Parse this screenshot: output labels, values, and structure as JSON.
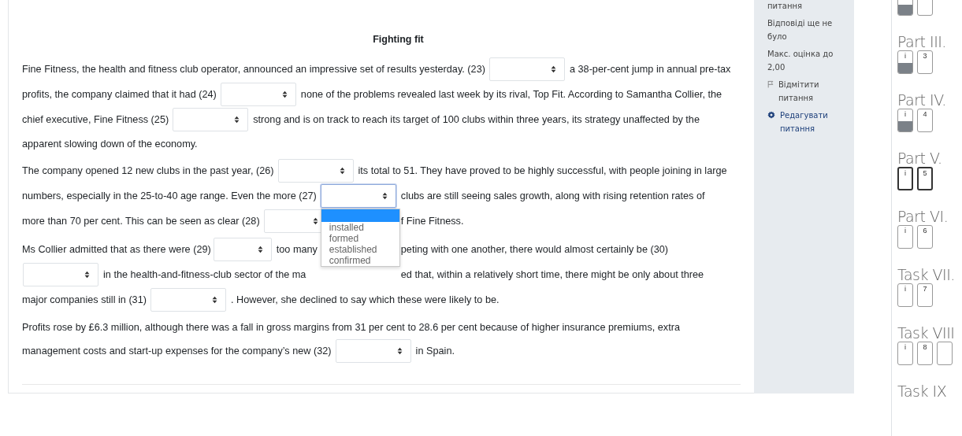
{
  "passage": {
    "title": "Fighting fit",
    "paragraphs": [
      {
        "lines": [
          [
            {
              "kind": "text",
              "text": "Fine Fitness, the health and fitness club operator, announced an impressive set of results yesterday. (23)"
            },
            {
              "kind": "select",
              "open": false
            },
            {
              "kind": "text",
              "text": "a 38-per-cent jump in annual pre-tax"
            }
          ],
          [
            {
              "kind": "text",
              "text": "profits, the company claimed that it had (24)"
            },
            {
              "kind": "select",
              "open": false
            },
            {
              "kind": "text",
              "text": "none of the problems revealed last week by its rival, Top Fit. According to Samantha Collier, the"
            }
          ],
          [
            {
              "kind": "text",
              "text": "chief executive, Fine Fitness (25)"
            },
            {
              "kind": "select",
              "open": false
            },
            {
              "kind": "text",
              "text": "strong and is on track to reach its target of 100 clubs within three years, its strategy unaffected by the"
            }
          ],
          [
            {
              "kind": "text",
              "text": "apparent slowing down of the economy."
            }
          ]
        ]
      },
      {
        "lines": [
          [
            {
              "kind": "text",
              "text": "The company opened 12 new clubs in the past year, (26)"
            },
            {
              "kind": "select",
              "open": false
            },
            {
              "kind": "text",
              "text": "its total to 51. They have proved to be highly successful, with people joining in large"
            }
          ],
          [
            {
              "kind": "text",
              "text": "numbers, especially in the 25-to-40 age range. Even the more (27)"
            },
            {
              "kind": "select",
              "open": true,
              "options": [
                {
                  "selected": true
                },
                {
                  "label": "installed",
                  "selected": false
                },
                {
                  "label": "formed",
                  "selected": false
                },
                {
                  "label": "established",
                  "selected": false
                },
                {
                  "label": "confirmed",
                  "selected": false
                }
              ]
            },
            {
              "kind": "text",
              "text": "clubs are still seeing sales growth, along with rising retention rates of"
            }
          ],
          [
            {
              "kind": "text",
              "text": "more than 70 per cent. This can be seen as clear (28)"
            },
            {
              "kind": "select",
              "open": false
            },
            {
              "kind": "covered"
            },
            {
              "kind": "text",
              "text": "f Fine Fitness."
            }
          ]
        ]
      },
      {
        "lines": [
          [
            {
              "kind": "text",
              "text": "Ms Collier admitted that as there were (29)"
            },
            {
              "kind": "select",
              "open": false
            },
            {
              "kind": "text",
              "text": "too many"
            },
            {
              "kind": "covered"
            },
            {
              "kind": "text",
              "text": "peting with one another, there would almost certainly be (30)"
            }
          ],
          [
            {
              "kind": "select",
              "open": false
            },
            {
              "kind": "text",
              "text": "in the health-and-fitness-club sector of the ma"
            },
            {
              "kind": "covered"
            },
            {
              "kind": "text",
              "text": "ed that, within a relatively short time, there might be only about three"
            }
          ],
          [
            {
              "kind": "text",
              "text": "major companies still in (31)"
            },
            {
              "kind": "select",
              "open": false
            },
            {
              "kind": "text",
              "text": ". However, she declined to say which these were likely to be."
            }
          ]
        ]
      },
      {
        "lines": [
          [
            {
              "kind": "text",
              "text": "Profits rose by £6.3 million, although there was a fall in gross margins from 31 per cent to 28.6 per cent because of higher insurance premiums, extra"
            }
          ],
          [
            {
              "kind": "text",
              "text": "management costs and start-up expenses for the company’s new (32)"
            },
            {
              "kind": "select",
              "open": false
            },
            {
              "kind": "text",
              "text": "in Spain."
            }
          ]
        ]
      }
    ]
  },
  "question_info": {
    "label": "питання",
    "status": "Відповіді ще не було",
    "max_grade": "Макс. оцінка до 2,00",
    "flag_link": "Відмітити питання",
    "edit_link": "Редагувати питання"
  },
  "quiz_navigation": {
    "sections": [
      {
        "buttons": [
          {
            "answered": true,
            "current": false
          },
          {
            "answered": false,
            "current": false
          }
        ]
      },
      {
        "title": "Part III.",
        "buttons": [
          {
            "label": "i",
            "answered": true,
            "current": false
          },
          {
            "label": "3",
            "answered": false,
            "current": false
          }
        ]
      },
      {
        "title": "Part IV.",
        "buttons": [
          {
            "label": "i",
            "answered": true,
            "current": false
          },
          {
            "label": "4",
            "answered": false,
            "current": false
          }
        ]
      },
      {
        "title": "Part V.",
        "buttons": [
          {
            "label": "i",
            "answered": false,
            "current": true
          },
          {
            "label": "5",
            "answered": false,
            "current": true
          }
        ]
      },
      {
        "title": "Part VI.",
        "buttons": [
          {
            "label": "i",
            "answered": false,
            "current": false
          },
          {
            "label": "6",
            "answered": false,
            "current": false
          }
        ]
      },
      {
        "title": "Task VII.",
        "buttons": [
          {
            "label": "i",
            "answered": false,
            "current": false
          },
          {
            "label": "7",
            "answered": false,
            "current": false
          }
        ]
      },
      {
        "title": "Task VIII",
        "buttons": [
          {
            "label": "i",
            "answered": false,
            "current": false
          },
          {
            "label": "8",
            "answered": false,
            "current": false
          },
          {
            "answered": false,
            "current": false
          }
        ]
      },
      {
        "title": "Task IX"
      }
    ]
  }
}
